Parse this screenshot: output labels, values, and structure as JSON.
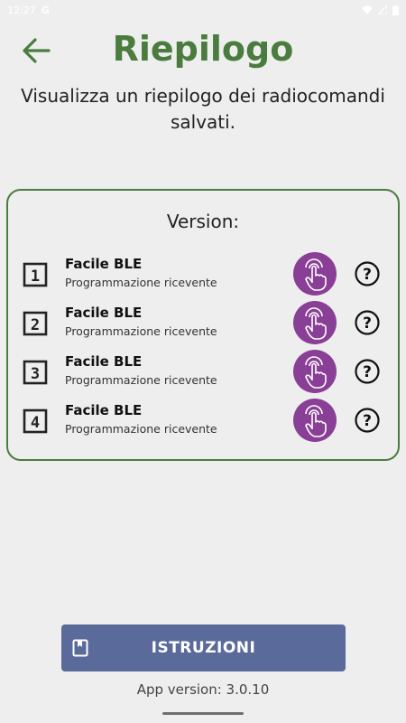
{
  "status_bar": {
    "time": "12:27",
    "carrier_icon": "G",
    "icons": [
      "wifi-icon",
      "signal-icon",
      "battery-icon"
    ]
  },
  "header": {
    "title": "Riepilogo",
    "back_icon": "arrow-left-icon"
  },
  "subtitle": "Visualizza un riepilogo dei radiocomandi salvati.",
  "card": {
    "title": "Version:",
    "remotes": [
      {
        "number": "1",
        "name": "Facile BLE",
        "description": "Programmazione ricevente"
      },
      {
        "number": "2",
        "name": "Facile BLE",
        "description": "Programmazione ricevente"
      },
      {
        "number": "3",
        "name": "Facile BLE",
        "description": "Programmazione ricevente"
      },
      {
        "number": "4",
        "name": "Facile BLE",
        "description": "Programmazione ricevente"
      }
    ]
  },
  "footer": {
    "istruzioni_label": "ISTRUZIONI",
    "app_version": "App version: 3.0.10"
  },
  "colors": {
    "accent_green": "#4a7c3f",
    "touch_purple": "#8a3f96",
    "button_blue": "#5a6a9a"
  }
}
